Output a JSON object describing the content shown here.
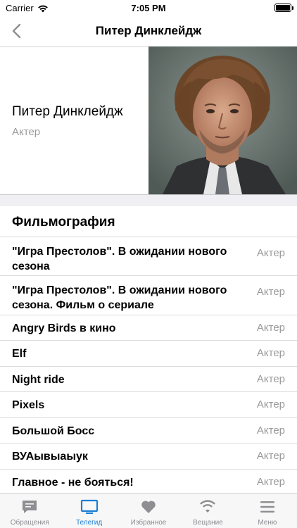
{
  "status": {
    "carrier": "Carrier",
    "time": "7:05 PM"
  },
  "nav": {
    "title": "Питер Динклейдж"
  },
  "person": {
    "name": "Питер Динклейдж",
    "role": "Актер"
  },
  "filmography": {
    "title": "Фильмография",
    "items": [
      {
        "title": "\"Игра Престолов\". В ожидании нового сезона",
        "role": "Актер"
      },
      {
        "title": "\"Игра Престолов\". В ожидании нового сезона. Фильм о сериале",
        "role": "Актер"
      },
      {
        "title": "Angry Birds в кино",
        "role": "Актер"
      },
      {
        "title": "Elf",
        "role": "Актер"
      },
      {
        "title": "Night ride",
        "role": "Актер"
      },
      {
        "title": "Pixels",
        "role": "Актер"
      },
      {
        "title": "Большой Босс",
        "role": "Актер"
      },
      {
        "title": "ВУАывыаыук",
        "role": "Актер"
      },
      {
        "title": "Главное - не бояться!",
        "role": "Актер"
      }
    ]
  },
  "tabbar": {
    "items": [
      {
        "label": "Обращения",
        "icon": "chat-bubble-icon"
      },
      {
        "label": "Телегид",
        "icon": "tv-icon"
      },
      {
        "label": "Избранное",
        "icon": "heart-icon"
      },
      {
        "label": "Вещание",
        "icon": "wifi-broadcast-icon"
      },
      {
        "label": "Меню",
        "icon": "menu-icon"
      }
    ],
    "active_color": "#1b7fd6",
    "inactive_color": "#8e8e93"
  }
}
